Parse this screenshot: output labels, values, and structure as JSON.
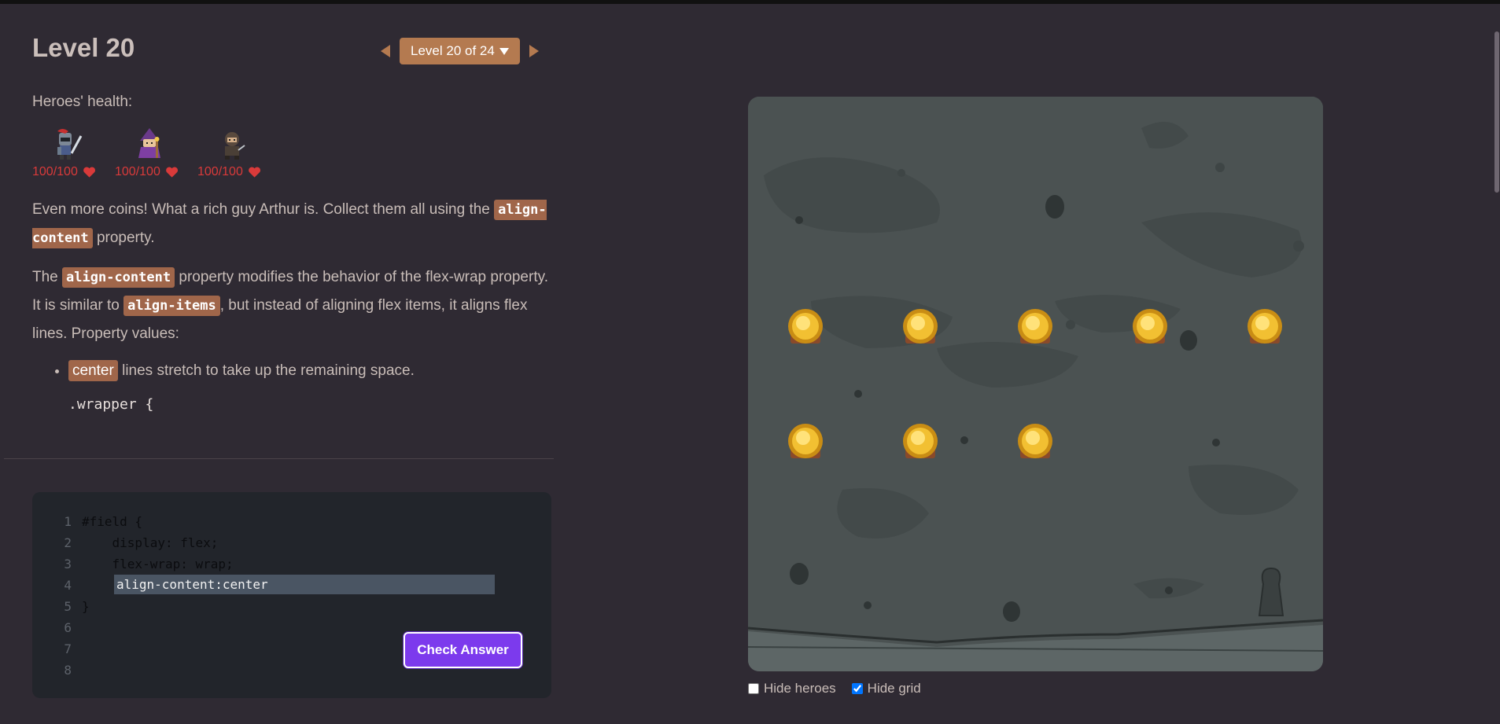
{
  "header": {
    "title": "Level 20",
    "level_select": "Level 20 of 24"
  },
  "health": {
    "label": "Heroes' health:",
    "heroes": [
      {
        "name": "knight-hero",
        "hp": "100/100"
      },
      {
        "name": "wizard-hero",
        "hp": "100/100"
      },
      {
        "name": "rogue-hero",
        "hp": "100/100"
      }
    ]
  },
  "instructions": {
    "p1_text1": "Even more coins! What a rich guy Arthur is. Collect them all using the",
    "p1_code": "align-content",
    "p1_text2": "property.",
    "p2_text1": "The",
    "p2_code1": "align-content",
    "p2_text2": "property modifies the behavior of the flex-wrap property. It is similar to",
    "p2_code2": "align-items",
    "p2_text3": ", but instead of aligning flex items, it aligns flex lines. Property values:",
    "list_item_tag": "center",
    "list_item_text": "lines stretch to take up the remaining space.",
    "snippet_line": ".wrapper {"
  },
  "editor": {
    "line_numbers": [
      "1",
      "2",
      "3",
      "4",
      "5",
      "6",
      "7",
      "8"
    ],
    "line1": "#field {",
    "line2": "    display: flex;",
    "line3": "    flex-wrap: wrap;",
    "line5": "}",
    "input_value": "align-content:center",
    "check_label": "Check Answer"
  },
  "board": {
    "coins": 8
  },
  "options": {
    "hide_heroes_label": "Hide heroes",
    "hide_heroes_checked": false,
    "hide_grid_label": "Hide grid",
    "hide_grid_checked": true
  },
  "colors": {
    "accent": "#b47a50",
    "button": "#7c3aed",
    "health": "#d93a3a"
  }
}
